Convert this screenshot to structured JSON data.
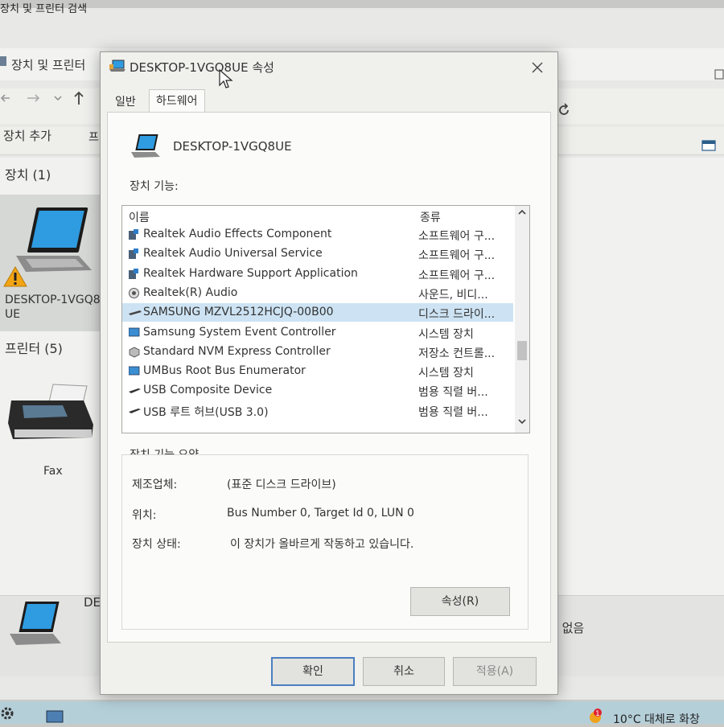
{
  "explorer": {
    "title": "장치 및 프린터",
    "search_placeholder": "장치 및 프린터 검색",
    "add_device": "장치 추가",
    "print_fragment": "프",
    "devices_header": "장치 (1)",
    "device_name": "DESKTOP-1VGQ8UE",
    "printers_header": "프린터 (5)",
    "fax_label": "Fax",
    "bottom_name_fragment": "DE",
    "bottom_status_fragment": "수 없음"
  },
  "taskbar": {
    "weather_text": "10°C 대체로 화창",
    "badge": "1"
  },
  "dialog": {
    "title": "DESKTOP-1VGQ8UE 속성",
    "tabs": [
      {
        "label": "일반"
      },
      {
        "label": "하드웨어"
      }
    ],
    "device_name": "DESKTOP-1VGQ8UE",
    "functions_label": "장치 기능:",
    "list": {
      "col_name": "이름",
      "col_type": "종류",
      "rows": [
        {
          "name": "Realtek Audio Effects Component",
          "type": "소프트웨어 구...",
          "icon": "software-component-icon"
        },
        {
          "name": "Realtek Audio Universal Service",
          "type": "소프트웨어 구...",
          "icon": "software-component-icon"
        },
        {
          "name": "Realtek Hardware Support Application",
          "type": "소프트웨어 구...",
          "icon": "software-component-icon"
        },
        {
          "name": "Realtek(R) Audio",
          "type": "사운드, 비디...",
          "icon": "speaker-icon"
        },
        {
          "name": "SAMSUNG MZVL2512HCJQ-00B00",
          "type": "디스크 드라이...",
          "icon": "disk-drive-icon"
        },
        {
          "name": "Samsung System Event Controller",
          "type": "시스템 장치",
          "icon": "system-device-icon"
        },
        {
          "name": "Standard NVM Express Controller",
          "type": "저장소 컨트롤...",
          "icon": "storage-controller-icon"
        },
        {
          "name": "UMBus Root Bus Enumerator",
          "type": "시스템 장치",
          "icon": "system-device-icon"
        },
        {
          "name": "USB Composite Device",
          "type": "범용 직렬 버...",
          "icon": "usb-icon"
        },
        {
          "name": "USB 루트 허브(USB 3.0)",
          "type": "범용 직렬 버...",
          "icon": "usb-icon"
        }
      ],
      "selected_index": 4
    },
    "summary": {
      "title": "장치 기능 요약",
      "manufacturer_label": "제조업체:",
      "manufacturer_value": "(표준 디스크 드라이브)",
      "location_label": "위치:",
      "location_value": "Bus Number 0, Target Id 0, LUN 0",
      "status_label": "장치 상태:",
      "status_value": "이 장치가 올바르게 작동하고 있습니다.",
      "properties_button": "속성(R)"
    },
    "buttons": {
      "ok": "확인",
      "cancel": "취소",
      "apply": "적용(A)"
    }
  }
}
